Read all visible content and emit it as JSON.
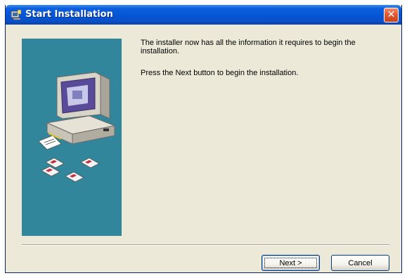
{
  "window": {
    "title": "Start Installation",
    "icons": {
      "title": "installer-icon",
      "close": "close-icon"
    },
    "colors": {
      "titlebar": "#0555d6",
      "panel": "#31869b",
      "close": "#e25a33"
    }
  },
  "content": {
    "line1": "The installer now has all the information it requires to begin the installation.",
    "line2": "Press the Next button to begin the installation."
  },
  "panel": {
    "illustration": "computer-with-disks-illustration"
  },
  "buttons": {
    "next_label": "Next >",
    "cancel_label": "Cancel",
    "close_glyph": "✕"
  }
}
